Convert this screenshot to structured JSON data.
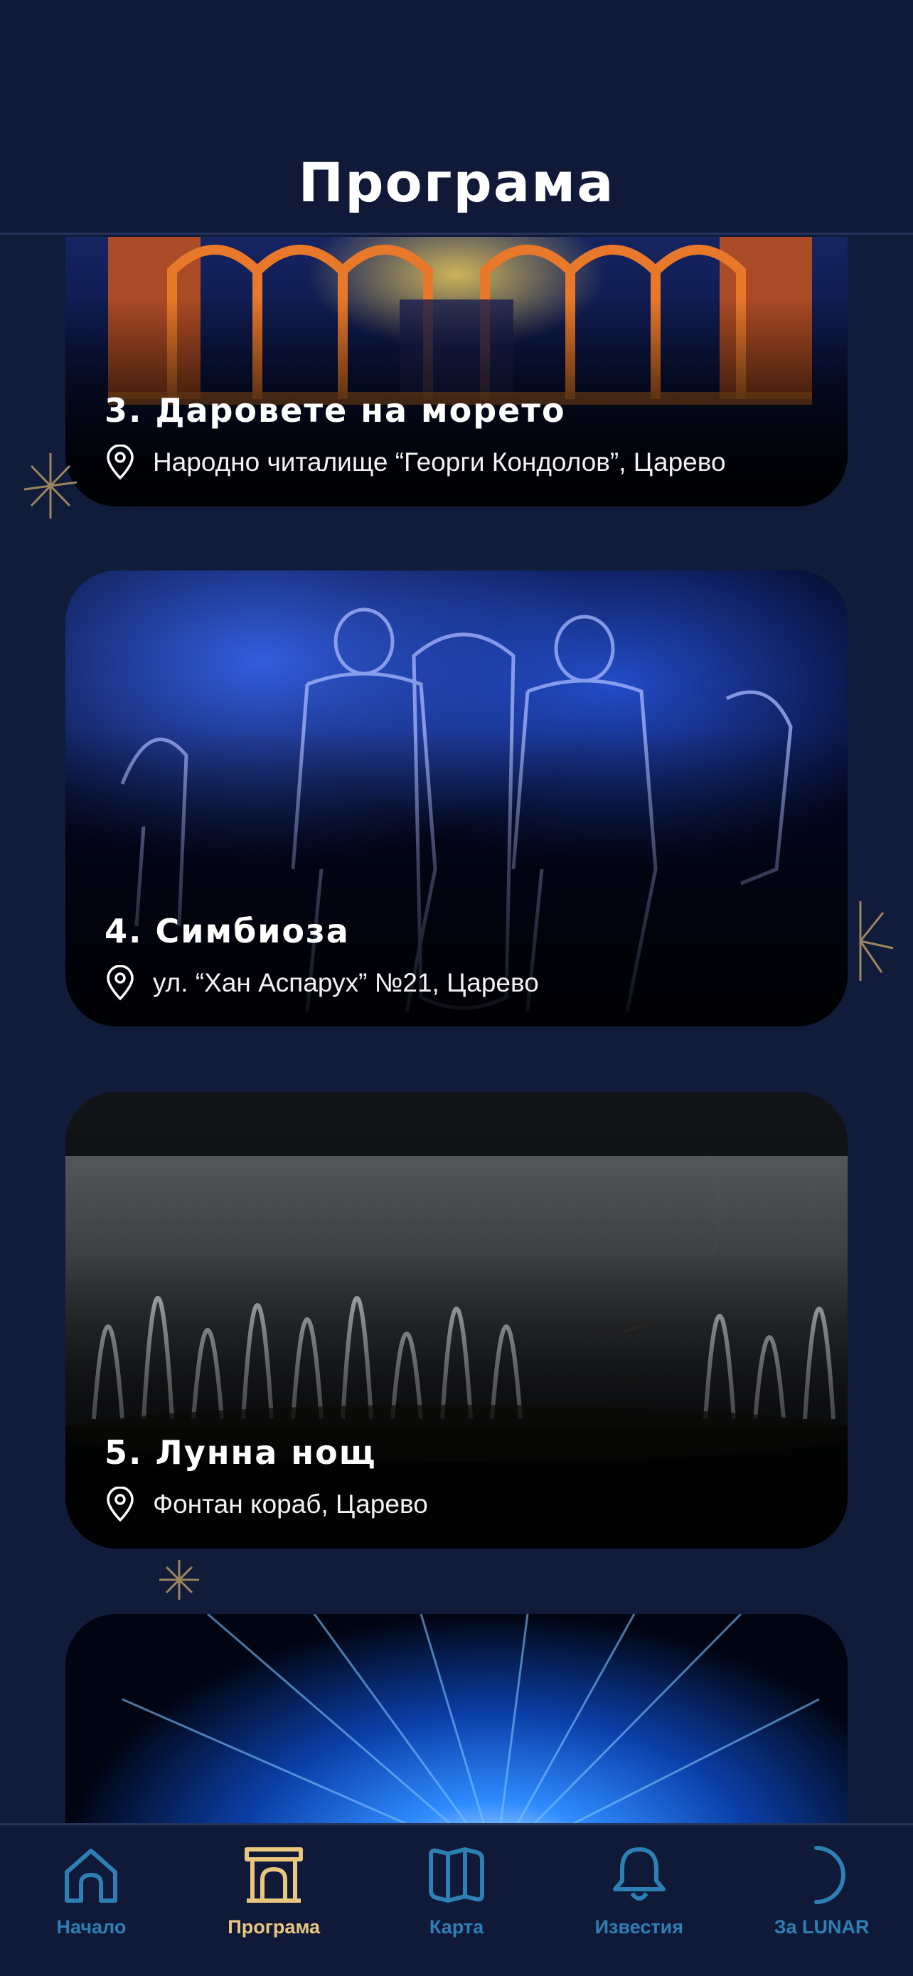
{
  "header": {
    "title": "Програма"
  },
  "cards": [
    {
      "title": "3. Даровете на морето",
      "location": "Народно читалище “Георги Кондолов”, Царево"
    },
    {
      "title": "4. Симбиоза",
      "location": "ул. “Хан Аспарух” №21, Царево"
    },
    {
      "title": "5. Лунна нощ",
      "location": "Фонтан кораб, Царево"
    },
    {
      "title": "",
      "location": ""
    }
  ],
  "tabbar": {
    "items": [
      {
        "label": "Начало",
        "icon": "home-icon",
        "active": false
      },
      {
        "label": "Програма",
        "icon": "arch-icon",
        "active": true
      },
      {
        "label": "Карта",
        "icon": "map-icon",
        "active": false
      },
      {
        "label": "Известия",
        "icon": "bell-icon",
        "active": false
      },
      {
        "label": "За LUNAR",
        "icon": "moon-icon",
        "active": false
      }
    ]
  },
  "colors": {
    "background": "#111b3a",
    "tab_inactive": "#2d7fb4",
    "tab_active": "#e9c77e",
    "sparkle": "#9c8660"
  }
}
